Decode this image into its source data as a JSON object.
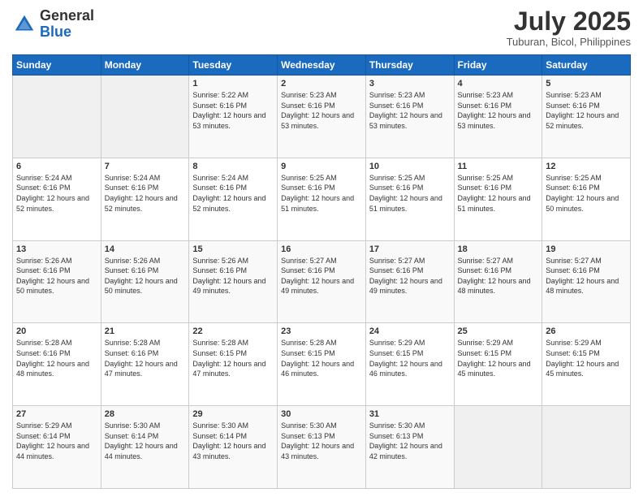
{
  "header": {
    "logo_general": "General",
    "logo_blue": "Blue",
    "month_year": "July 2025",
    "location": "Tuburan, Bicol, Philippines"
  },
  "days_of_week": [
    "Sunday",
    "Monday",
    "Tuesday",
    "Wednesday",
    "Thursday",
    "Friday",
    "Saturday"
  ],
  "weeks": [
    [
      {
        "day": "",
        "info": ""
      },
      {
        "day": "",
        "info": ""
      },
      {
        "day": "1",
        "info": "Sunrise: 5:22 AM\nSunset: 6:16 PM\nDaylight: 12 hours and 53 minutes."
      },
      {
        "day": "2",
        "info": "Sunrise: 5:23 AM\nSunset: 6:16 PM\nDaylight: 12 hours and 53 minutes."
      },
      {
        "day": "3",
        "info": "Sunrise: 5:23 AM\nSunset: 6:16 PM\nDaylight: 12 hours and 53 minutes."
      },
      {
        "day": "4",
        "info": "Sunrise: 5:23 AM\nSunset: 6:16 PM\nDaylight: 12 hours and 53 minutes."
      },
      {
        "day": "5",
        "info": "Sunrise: 5:23 AM\nSunset: 6:16 PM\nDaylight: 12 hours and 52 minutes."
      }
    ],
    [
      {
        "day": "6",
        "info": "Sunrise: 5:24 AM\nSunset: 6:16 PM\nDaylight: 12 hours and 52 minutes."
      },
      {
        "day": "7",
        "info": "Sunrise: 5:24 AM\nSunset: 6:16 PM\nDaylight: 12 hours and 52 minutes."
      },
      {
        "day": "8",
        "info": "Sunrise: 5:24 AM\nSunset: 6:16 PM\nDaylight: 12 hours and 52 minutes."
      },
      {
        "day": "9",
        "info": "Sunrise: 5:25 AM\nSunset: 6:16 PM\nDaylight: 12 hours and 51 minutes."
      },
      {
        "day": "10",
        "info": "Sunrise: 5:25 AM\nSunset: 6:16 PM\nDaylight: 12 hours and 51 minutes."
      },
      {
        "day": "11",
        "info": "Sunrise: 5:25 AM\nSunset: 6:16 PM\nDaylight: 12 hours and 51 minutes."
      },
      {
        "day": "12",
        "info": "Sunrise: 5:25 AM\nSunset: 6:16 PM\nDaylight: 12 hours and 50 minutes."
      }
    ],
    [
      {
        "day": "13",
        "info": "Sunrise: 5:26 AM\nSunset: 6:16 PM\nDaylight: 12 hours and 50 minutes."
      },
      {
        "day": "14",
        "info": "Sunrise: 5:26 AM\nSunset: 6:16 PM\nDaylight: 12 hours and 50 minutes."
      },
      {
        "day": "15",
        "info": "Sunrise: 5:26 AM\nSunset: 6:16 PM\nDaylight: 12 hours and 49 minutes."
      },
      {
        "day": "16",
        "info": "Sunrise: 5:27 AM\nSunset: 6:16 PM\nDaylight: 12 hours and 49 minutes."
      },
      {
        "day": "17",
        "info": "Sunrise: 5:27 AM\nSunset: 6:16 PM\nDaylight: 12 hours and 49 minutes."
      },
      {
        "day": "18",
        "info": "Sunrise: 5:27 AM\nSunset: 6:16 PM\nDaylight: 12 hours and 48 minutes."
      },
      {
        "day": "19",
        "info": "Sunrise: 5:27 AM\nSunset: 6:16 PM\nDaylight: 12 hours and 48 minutes."
      }
    ],
    [
      {
        "day": "20",
        "info": "Sunrise: 5:28 AM\nSunset: 6:16 PM\nDaylight: 12 hours and 48 minutes."
      },
      {
        "day": "21",
        "info": "Sunrise: 5:28 AM\nSunset: 6:16 PM\nDaylight: 12 hours and 47 minutes."
      },
      {
        "day": "22",
        "info": "Sunrise: 5:28 AM\nSunset: 6:15 PM\nDaylight: 12 hours and 47 minutes."
      },
      {
        "day": "23",
        "info": "Sunrise: 5:28 AM\nSunset: 6:15 PM\nDaylight: 12 hours and 46 minutes."
      },
      {
        "day": "24",
        "info": "Sunrise: 5:29 AM\nSunset: 6:15 PM\nDaylight: 12 hours and 46 minutes."
      },
      {
        "day": "25",
        "info": "Sunrise: 5:29 AM\nSunset: 6:15 PM\nDaylight: 12 hours and 45 minutes."
      },
      {
        "day": "26",
        "info": "Sunrise: 5:29 AM\nSunset: 6:15 PM\nDaylight: 12 hours and 45 minutes."
      }
    ],
    [
      {
        "day": "27",
        "info": "Sunrise: 5:29 AM\nSunset: 6:14 PM\nDaylight: 12 hours and 44 minutes."
      },
      {
        "day": "28",
        "info": "Sunrise: 5:30 AM\nSunset: 6:14 PM\nDaylight: 12 hours and 44 minutes."
      },
      {
        "day": "29",
        "info": "Sunrise: 5:30 AM\nSunset: 6:14 PM\nDaylight: 12 hours and 43 minutes."
      },
      {
        "day": "30",
        "info": "Sunrise: 5:30 AM\nSunset: 6:13 PM\nDaylight: 12 hours and 43 minutes."
      },
      {
        "day": "31",
        "info": "Sunrise: 5:30 AM\nSunset: 6:13 PM\nDaylight: 12 hours and 42 minutes."
      },
      {
        "day": "",
        "info": ""
      },
      {
        "day": "",
        "info": ""
      }
    ]
  ]
}
